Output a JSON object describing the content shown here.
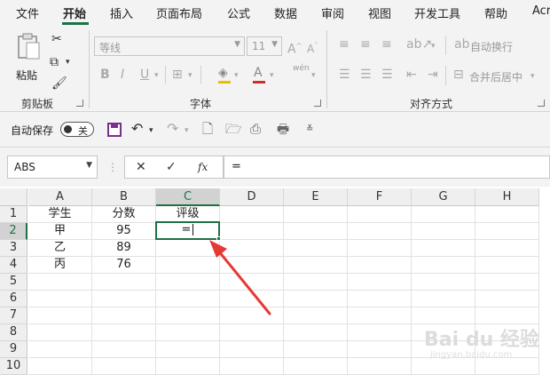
{
  "ribbon_tabs": [
    "文件",
    "开始",
    "插入",
    "页面布局",
    "公式",
    "数据",
    "审阅",
    "视图",
    "开发工具",
    "帮助",
    "Acr"
  ],
  "active_tab": "开始",
  "clipboard": {
    "paste_label": "粘贴",
    "group_label": "剪贴板"
  },
  "font": {
    "name_placeholder": "等线",
    "size_value": "11",
    "group_label": "字体",
    "bold": "B",
    "italic": "I",
    "underline": "U",
    "phonetic": "wén"
  },
  "alignment": {
    "wrap_text": "自动换行",
    "merge_center": "合并后居中",
    "group_label": "对齐方式"
  },
  "qat": {
    "autosave_label": "自动保存",
    "toggle_state": "关"
  },
  "formula_bar": {
    "name_box": "ABS",
    "cancel": "✕",
    "enter": "✓",
    "fx": "fx",
    "formula": "="
  },
  "grid": {
    "columns": [
      "A",
      "B",
      "C",
      "D",
      "E",
      "F",
      "G",
      "H"
    ],
    "rows": [
      "1",
      "2",
      "3",
      "4",
      "5",
      "6",
      "7",
      "8",
      "9",
      "10"
    ],
    "cells": {
      "A1": "学生",
      "B1": "分数",
      "C1": "评级",
      "A2": "甲",
      "B2": "95",
      "A3": "乙",
      "B3": "89",
      "A4": "丙",
      "B4": "76"
    },
    "active_cell": "C2",
    "active_value": "="
  },
  "watermark": {
    "main": "Bai du 经验",
    "sub": "jingyan.baidu.com"
  },
  "colors": {
    "accent": "#1e7145",
    "arrow": "#e53935",
    "quick_save": "#7a2f8c"
  }
}
